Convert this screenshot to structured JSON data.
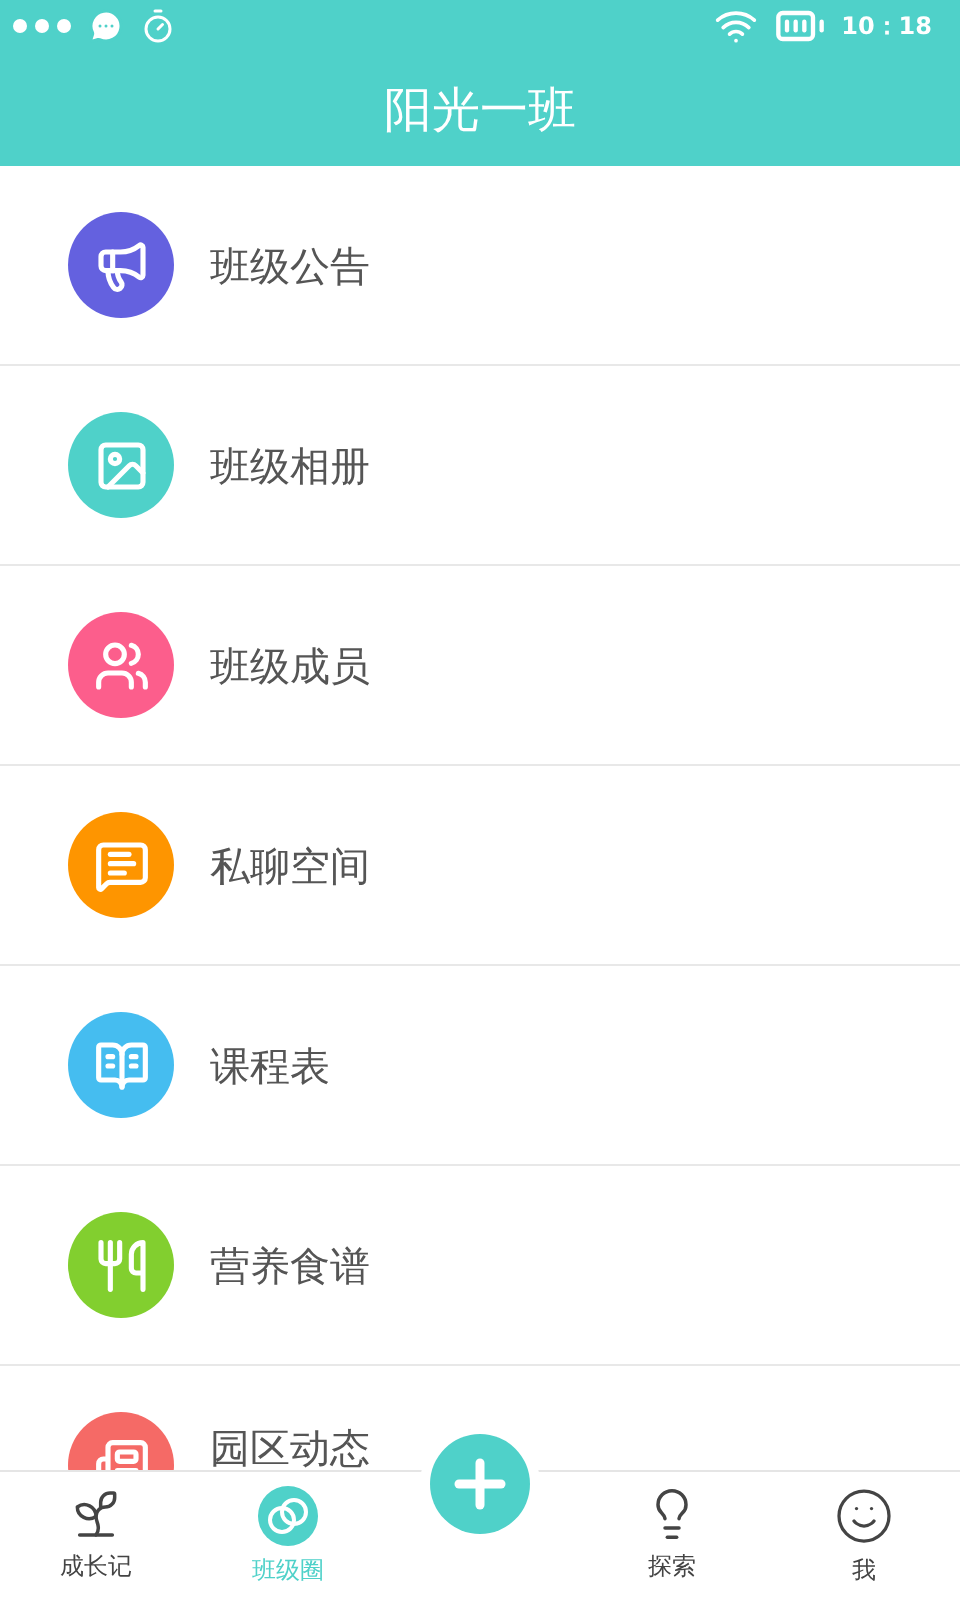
{
  "status_bar": {
    "time": "10：18"
  },
  "header": {
    "title": "阳光一班"
  },
  "menu": [
    {
      "kind": "announcement",
      "label": "班级公告",
      "color": "#6461df"
    },
    {
      "kind": "album",
      "label": "班级相册",
      "color": "#4fd1c9"
    },
    {
      "kind": "members",
      "label": "班级成员",
      "color": "#fc5e8c"
    },
    {
      "kind": "chat",
      "label": "私聊空间",
      "color": "#fe9500"
    },
    {
      "kind": "schedule",
      "label": "课程表",
      "color": "#45bdf0"
    },
    {
      "kind": "recipe",
      "label": "营养食谱",
      "color": "#82cf2f"
    },
    {
      "kind": "news",
      "label": "园区动态",
      "color": "#f56a66"
    }
  ],
  "tab_bar": [
    {
      "kind": "growth",
      "label": "成长记",
      "selected": false
    },
    {
      "kind": "circle",
      "label": "班级圈",
      "selected": true
    },
    {
      "kind": "add"
    },
    {
      "kind": "explore",
      "label": "探索",
      "selected": false
    },
    {
      "kind": "me",
      "label": "我",
      "selected": false
    }
  ]
}
